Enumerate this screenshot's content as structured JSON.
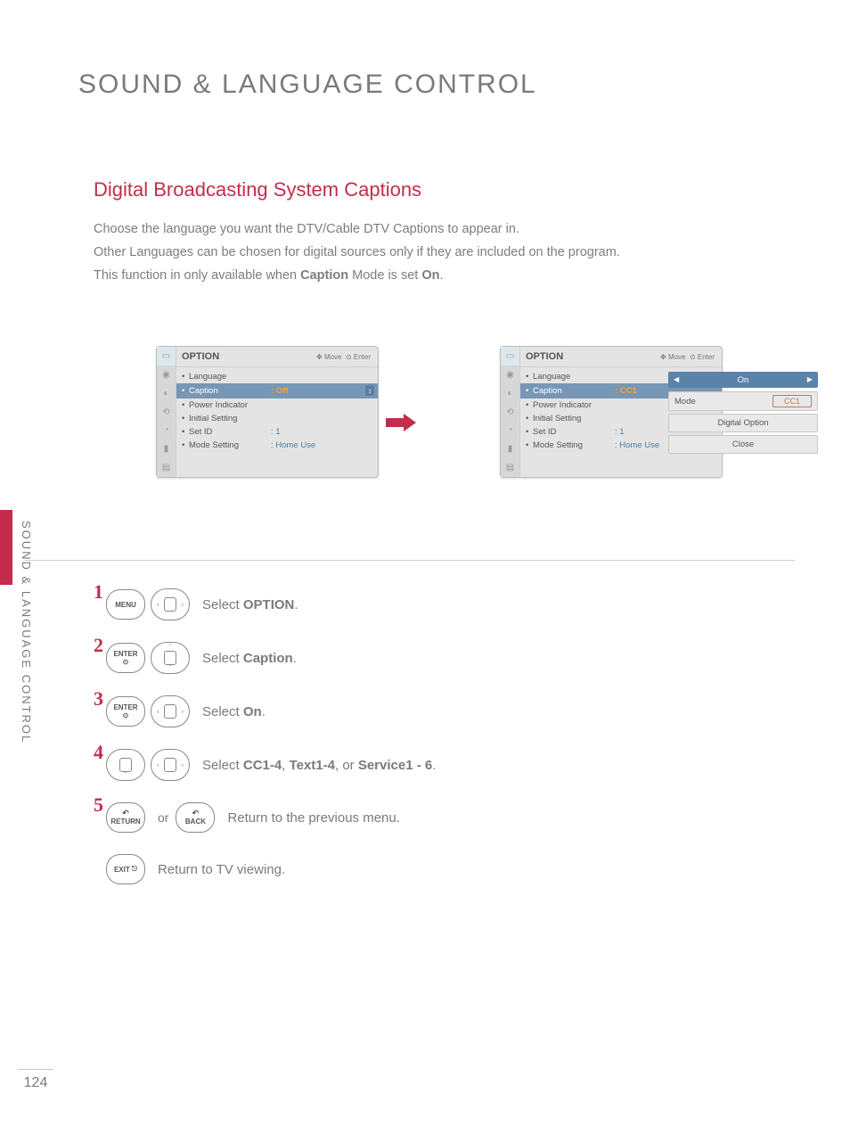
{
  "page": {
    "title": "SOUND & LANGUAGE CONTROL",
    "side_label": "SOUND & LANGUAGE CONTROL",
    "page_number": "124"
  },
  "section": {
    "title": "Digital Broadcasting System Captions",
    "intro_line1": "Choose the language you want the DTV/Cable DTV Captions to appear in.",
    "intro_line2": "Other Languages can be chosen for digital sources only if they are included on the program.",
    "intro_line3_a": "This function in only available when ",
    "intro_line3_b": "Caption",
    "intro_line3_c": " Mode is set ",
    "intro_line3_d": "On",
    "intro_line3_e": "."
  },
  "osd": {
    "title": "OPTION",
    "move_hint": "Move",
    "enter_hint": "Enter",
    "items": {
      "language": "Language",
      "caption": "Caption",
      "power_indicator": "Power Indicator",
      "initial_setting": "Initial Setting",
      "set_id": "Set ID",
      "mode_setting": "Mode Setting"
    },
    "values": {
      "caption_off": ": Off",
      "caption_cc1": ": CC1",
      "set_id": ": 1",
      "mode_setting": ": Home Use"
    }
  },
  "popup": {
    "on_label": "On",
    "mode_label": "Mode",
    "mode_value": "CC1",
    "digital_option": "Digital Option",
    "close": "Close"
  },
  "steps": {
    "s1": {
      "num": "1",
      "btn": "MENU",
      "text_a": "Select ",
      "text_b": "OPTION",
      "text_c": "."
    },
    "s2": {
      "num": "2",
      "btn": "ENTER",
      "text_a": "Select ",
      "text_b": "Caption",
      "text_c": "."
    },
    "s3": {
      "num": "3",
      "btn": "ENTER",
      "text_a": "Select ",
      "text_b": "On",
      "text_c": "."
    },
    "s4": {
      "num": "4",
      "text_a": "Select ",
      "text_b": "CC1-4",
      "text_c": ", ",
      "text_d": "Text1-4",
      "text_e": ", or ",
      "text_f": "Service1 - 6",
      "text_g": "."
    },
    "s5": {
      "num": "5",
      "btn1": "RETURN",
      "or": "or",
      "btn2": "BACK",
      "text": "Return to the previous menu."
    },
    "s6": {
      "btn": "EXIT",
      "text": "Return to TV viewing."
    }
  }
}
